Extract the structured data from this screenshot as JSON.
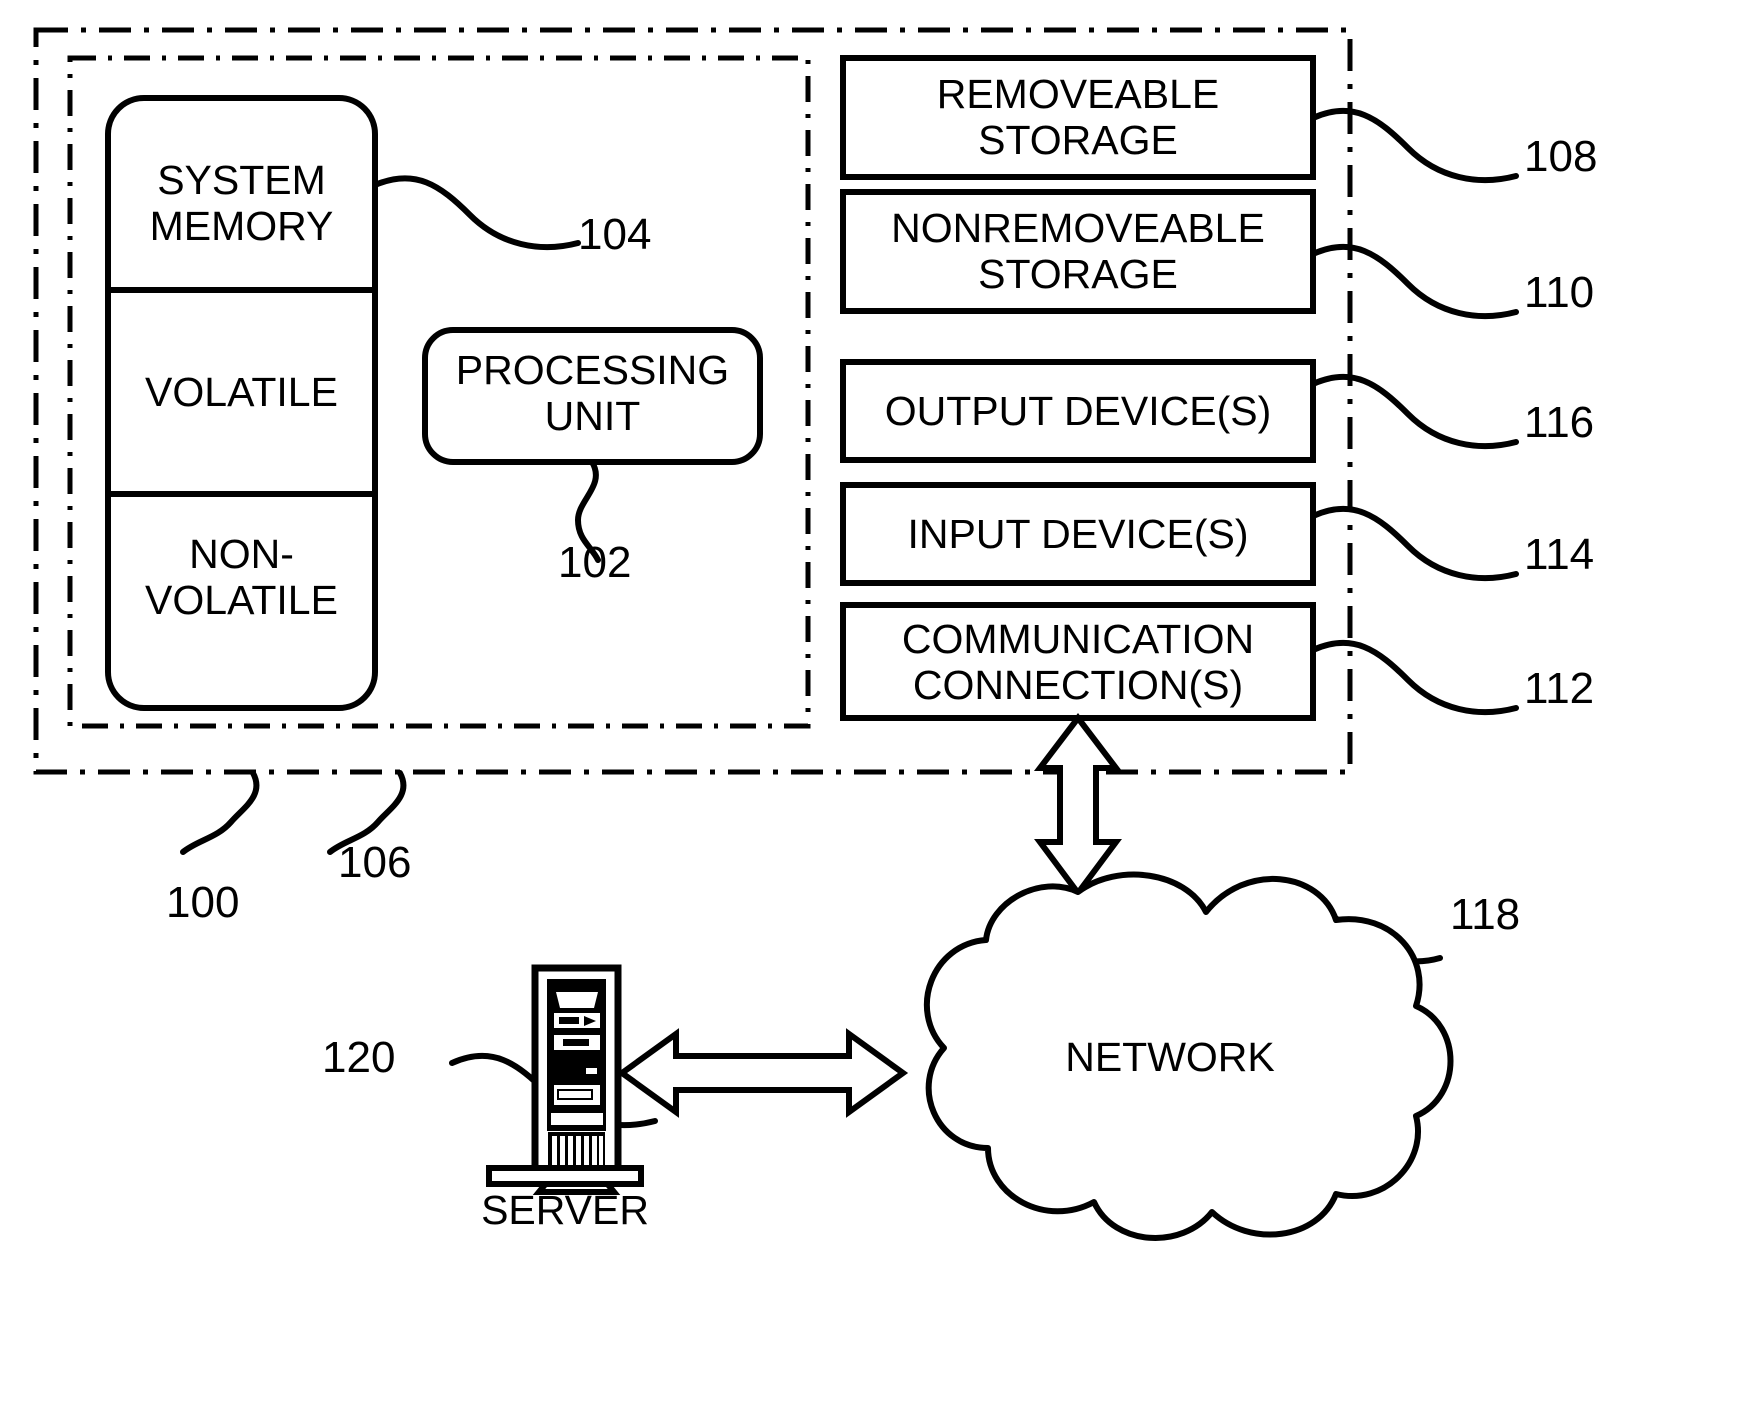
{
  "figure": {
    "type": "patent-block-diagram",
    "title": "Computing device block diagram with network and server"
  },
  "boundaries": {
    "outer": {
      "ref": "100",
      "style": "dash-dot"
    },
    "inner": {
      "ref": "106",
      "style": "dashed"
    }
  },
  "blocks": {
    "system_memory": "SYSTEM\nMEMORY",
    "volatile": "VOLATILE",
    "non_volatile": "NON-\nVOLATILE",
    "processing_unit": "PROCESSING\nUNIT",
    "removeable_storage": "REMOVEABLE\nSTORAGE",
    "nonremoveable_storage": "NONREMOVEABLE\nSTORAGE",
    "output_devices": "OUTPUT DEVICE(S)",
    "input_devices": "INPUT DEVICE(S)",
    "communication_connections": "COMMUNICATION\nCONNECTION(S)",
    "network": "NETWORK",
    "server": "SERVER"
  },
  "reference_numerals": {
    "computing_device": "100",
    "processing_unit": "102",
    "system_memory": "104",
    "inner_boundary": "106",
    "removeable_storage": "108",
    "nonremoveable_storage": "110",
    "communication_connections": "112",
    "input_devices": "114",
    "output_devices": "116",
    "network": "118",
    "server": "120"
  },
  "colors": {
    "stroke": "#000000",
    "background": "#ffffff"
  }
}
